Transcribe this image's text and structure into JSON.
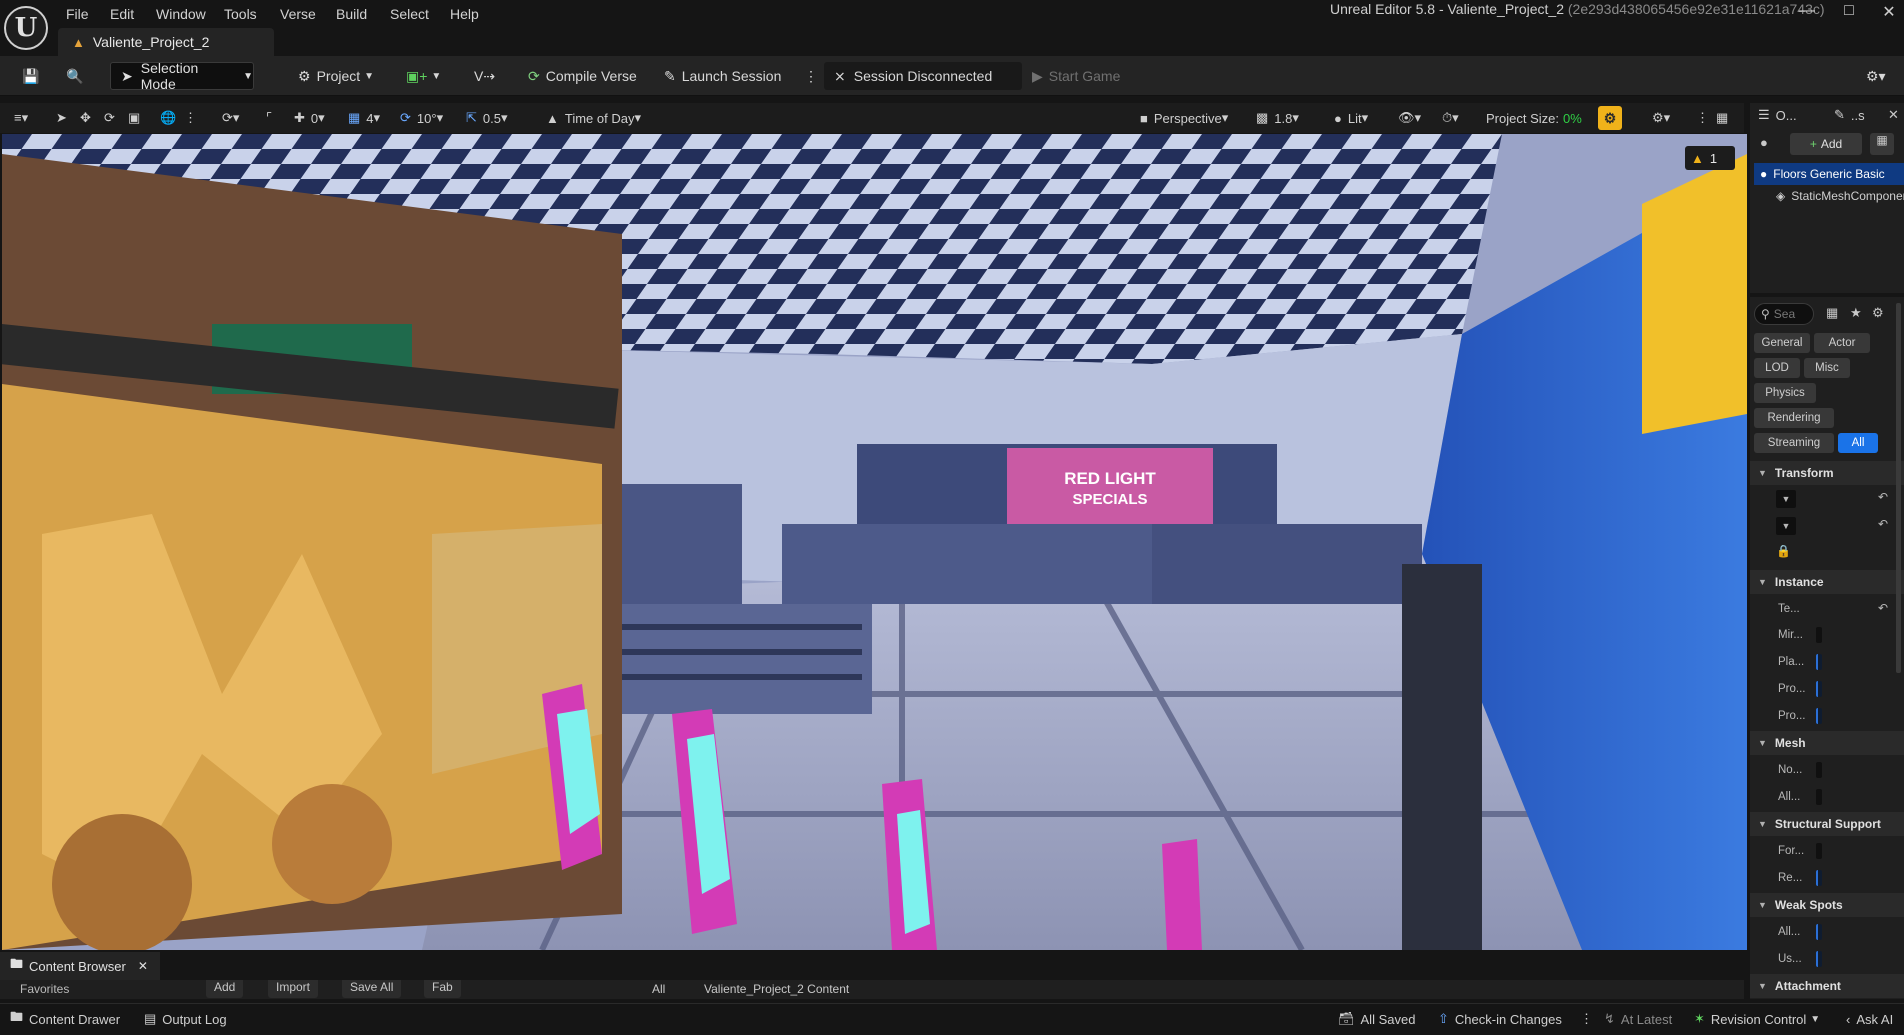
{
  "app": {
    "logo_glyph": "U",
    "window_title": "Unreal Editor 5.8 - Valiente_Project_2",
    "window_hash": "(2e293d438065456e92e31e11621a743c)",
    "menu": [
      "File",
      "Edit",
      "Window",
      "Tools",
      "Verse",
      "Build",
      "Select",
      "Help"
    ],
    "doc_tab": "Valiente_Project_2"
  },
  "toolbar": {
    "selection_mode": "Selection Mode",
    "project": "Project",
    "compile_verse": "Compile Verse",
    "launch_session": "Launch Session",
    "session_status": "Session Disconnected",
    "start_game": "Start Game"
  },
  "viewport_toolbar": {
    "translate_snap": "0",
    "grid_snap": "4",
    "rotate_snap": "10°",
    "scale_snap": "0.5",
    "time_of_day": "Time of Day",
    "perspective": "Perspective",
    "camera_speed": "1.8",
    "view_mode": "Lit",
    "project_size_label": "Project Size:",
    "project_size_value": "0%",
    "warning_count": "1"
  },
  "scene": {
    "sign_line1": "RED LIGHT",
    "sign_line2": "SPECIALS"
  },
  "outliner": {
    "title": "O...",
    "title2": "..s",
    "add_label": "Add",
    "items": [
      {
        "label": "Floors Generic Basic",
        "selected": true
      },
      {
        "label": "StaticMeshComponent",
        "selected": false
      }
    ]
  },
  "details": {
    "search_placeholder": "Sea",
    "filters": [
      "General",
      "Actor",
      "LOD",
      "Misc",
      "Physics",
      "Rendering",
      "Streaming",
      "All"
    ],
    "sections": [
      {
        "title": "Transform",
        "rows": [
          "",
          "",
          ""
        ]
      },
      {
        "title": "Instance",
        "rows": [
          "Te...",
          "Mir...",
          "Pla...",
          "Pro...",
          "Pro..."
        ]
      },
      {
        "title": "Mesh",
        "rows": [
          "No...",
          "All..."
        ]
      },
      {
        "title": "Structural Support",
        "rows": [
          "For...",
          "Re..."
        ]
      },
      {
        "title": "Weak Spots",
        "rows": [
          "All...",
          "Us..."
        ]
      },
      {
        "title": "Attachment",
        "rows": []
      }
    ]
  },
  "content_browser": {
    "tab": "Content Browser",
    "add": "Add",
    "import": "Import",
    "save_all": "Save All",
    "fab": "Fab",
    "path_root": "All",
    "path_project": "Valiente_Project_2 Content",
    "favorites": "Favorites"
  },
  "statusbar": {
    "content_drawer": "Content Drawer",
    "output_log": "Output Log",
    "all_saved": "All Saved",
    "check_in": "Check-in Changes",
    "at_latest": "At Latest",
    "revision_control": "Revision Control",
    "ask_ai": "Ask AI"
  },
  "colors": {
    "accent_blue": "#1a73e8",
    "project_size_green": "#2fcf45",
    "warning_yellow": "#f0b21a",
    "panel_bg": "#1f1f1f"
  }
}
